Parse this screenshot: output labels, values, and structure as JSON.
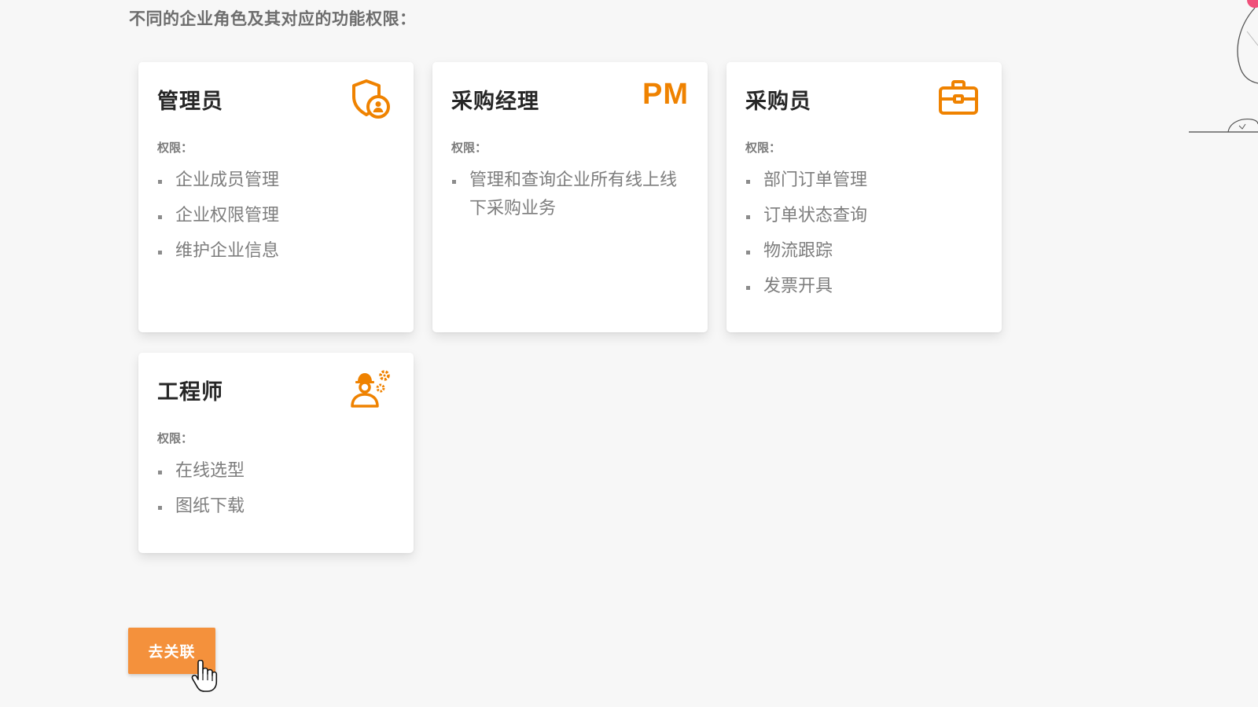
{
  "intro": {
    "text": "不同的企业角色及其对应的功能权限："
  },
  "roles": [
    {
      "title": "管理员",
      "icon": "shield-user-icon",
      "permission_label": "权限：",
      "permissions": [
        "企业成员管理",
        "企业权限管理",
        "维护企业信息"
      ]
    },
    {
      "title": "采购经理",
      "icon_text": "PM",
      "permission_label": "权限：",
      "permissions": [
        "管理和查询企业所有线上线下采购业务"
      ]
    },
    {
      "title": "采购员",
      "icon": "briefcase-icon",
      "permission_label": "权限：",
      "permissions": [
        "部门订单管理",
        "订单状态查询",
        "物流跟踪",
        "发票开具"
      ]
    },
    {
      "title": "工程师",
      "icon": "engineer-gear-icon",
      "permission_label": "权限：",
      "permissions": [
        "在线选型",
        "图纸下载"
      ]
    }
  ],
  "actions": {
    "link_button": "去关联"
  },
  "colors": {
    "accent": "#ef8200",
    "button": "#f4913c",
    "deco_pink": "#f0507a"
  }
}
